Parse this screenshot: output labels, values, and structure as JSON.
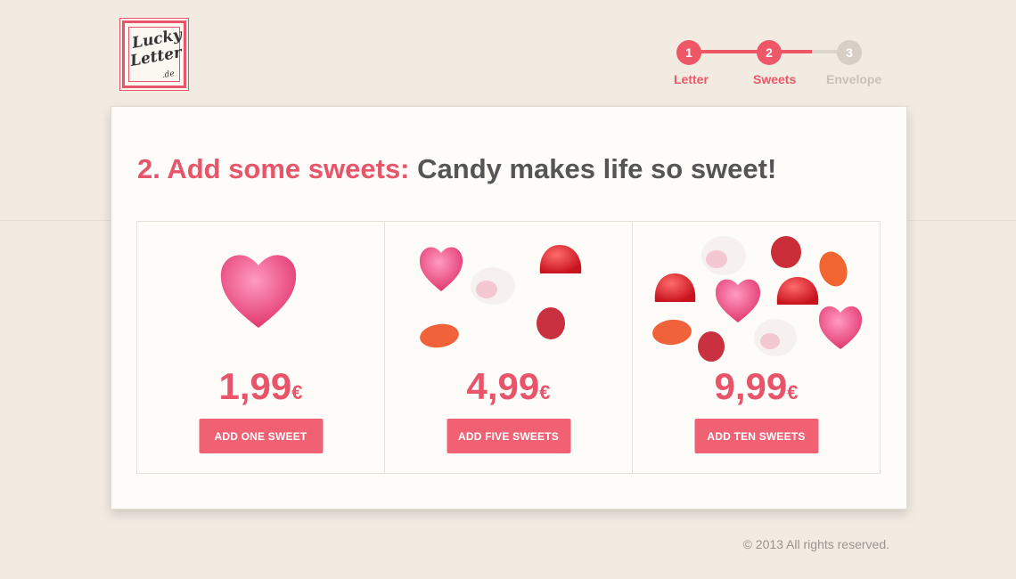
{
  "logo": {
    "line1": "Lucky",
    "line2": "Letter",
    "line3": ".de"
  },
  "steps": [
    {
      "number": "1",
      "label": "Letter",
      "state": "done"
    },
    {
      "number": "2",
      "label": "Sweets",
      "state": "active"
    },
    {
      "number": "3",
      "label": "Envelope",
      "state": "inactive"
    }
  ],
  "heading": {
    "accent": "2. Add some sweets:",
    "rest": " Candy makes life so sweet!"
  },
  "options": [
    {
      "price": "1,99",
      "currency": "€",
      "button": "ADD ONE SWEET"
    },
    {
      "price": "4,99",
      "currency": "€",
      "button": "ADD FIVE SWEETS"
    },
    {
      "price": "9,99",
      "currency": "€",
      "button": "ADD TEN SWEETS"
    }
  ],
  "footer": {
    "copyright": "© 2013 All rights reserved."
  },
  "colors": {
    "accent": "#e8556a",
    "button": "#f06273",
    "background": "#f1ebe2",
    "inactive": "#d7cfc5"
  }
}
